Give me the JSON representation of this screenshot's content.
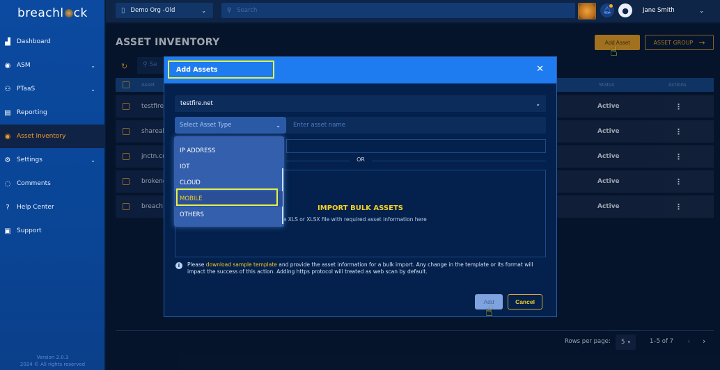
{
  "sidebar": {
    "logo": {
      "pre": "breachl",
      "post": "ck"
    },
    "items": [
      {
        "label": "Dashboard",
        "icon": "chart-icon",
        "glyph": "▟",
        "chevron": false,
        "active": false
      },
      {
        "label": "ASM",
        "icon": "target-icon",
        "glyph": "◉",
        "chevron": true,
        "active": false
      },
      {
        "label": "PTaaS",
        "icon": "users-icon",
        "glyph": "⚇",
        "chevron": true,
        "active": false
      },
      {
        "label": "Reporting",
        "icon": "report-icon",
        "glyph": "▤",
        "chevron": false,
        "active": false
      },
      {
        "label": "Asset Inventory",
        "icon": "asset-icon",
        "glyph": "◉",
        "chevron": false,
        "active": true
      },
      {
        "label": "Settings",
        "icon": "gear-icon",
        "glyph": "⚙",
        "chevron": true,
        "active": false
      },
      {
        "label": "Comments",
        "icon": "comment-icon",
        "glyph": "◌",
        "chevron": false,
        "active": false
      },
      {
        "label": "Help Center",
        "icon": "help-icon",
        "glyph": "?",
        "chevron": false,
        "active": false
      },
      {
        "label": "Support",
        "icon": "support-icon",
        "glyph": "▣",
        "chevron": false,
        "active": false
      }
    ],
    "version": "Version 2.0.3",
    "copyright": "2024 © All rights reserved"
  },
  "topbar": {
    "org": "Demo Org -Old",
    "search_placeholder": "Search",
    "user": "Jane Smith"
  },
  "page": {
    "title": "ASSET INVENTORY",
    "add_asset": "Add Asset",
    "asset_group": "ASSET GROUP",
    "table_search_placeholder": "Se"
  },
  "table": {
    "columns": {
      "asset": "Asset",
      "status": "Status",
      "actions": "Actions"
    },
    "rows": [
      {
        "asset": "testfire.",
        "status": "Active"
      },
      {
        "asset": "shareal",
        "status": "Active"
      },
      {
        "asset": "jnctn.co",
        "status": "Active"
      },
      {
        "asset": "brokene",
        "status": "Active"
      },
      {
        "asset": "breach",
        "status": "Active"
      }
    ]
  },
  "pagination": {
    "rows_per_page_label": "Rows per page:",
    "rows_per_page": "5",
    "range": "1–5 of 7"
  },
  "modal": {
    "title": "Add Assets",
    "org_value": "testfire.net",
    "asset_type_placeholder": "Select Asset Type",
    "asset_name_placeholder": "Enter asset name",
    "or": "OR",
    "import_title": "IMPORT BULK ASSETS",
    "import_sub": "he XLS or XLSX file with required asset information here",
    "info_pre": "Please ",
    "info_link": "download sample template",
    "info_post": " and provide the asset information for a bulk import. Any change in the template or its format will impact the success of this action. Adding https protocol will treated as web scan by default.",
    "add": "Add",
    "cancel": "Cancel"
  },
  "asset_type_menu": {
    "options": [
      "IP ADDRESS",
      "IOT",
      "CLOUD",
      "MOBILE",
      "OTHERS"
    ],
    "highlighted": "MOBILE"
  },
  "colors": {
    "accent": "#f6a823",
    "highlight": "#e6f04a",
    "modal_header": "#1f7cf0",
    "sidebar": "#0b4aa0"
  }
}
